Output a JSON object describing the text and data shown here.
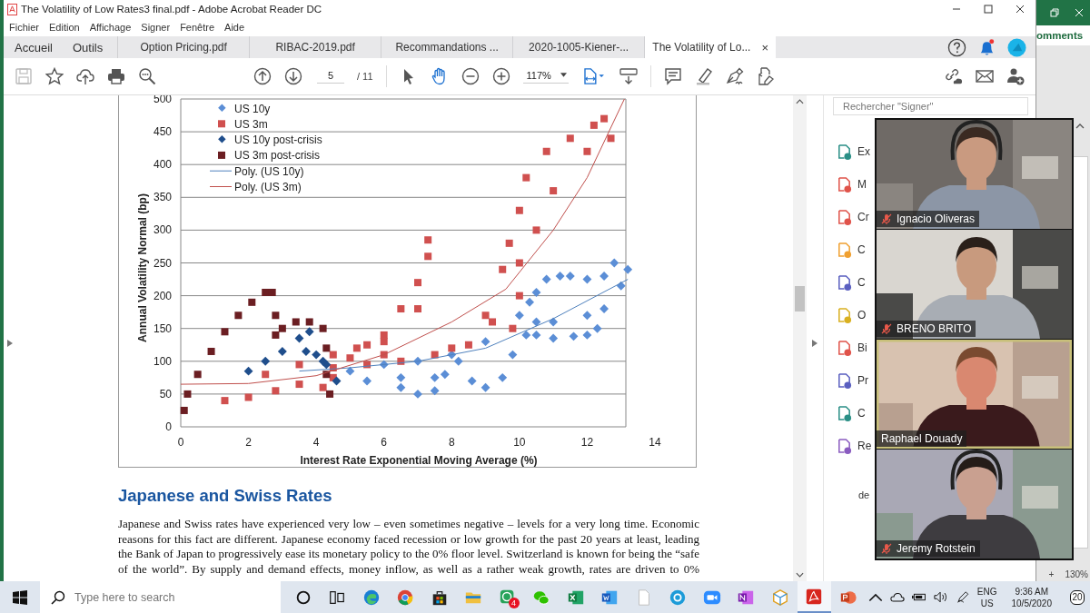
{
  "window": {
    "title": "The Volatility of Low Rates3 final.pdf - Adobe Acrobat Reader DC"
  },
  "menu": [
    "Fichier",
    "Edition",
    "Affichage",
    "Signer",
    "Fenêtre",
    "Aide"
  ],
  "nav_tabs": [
    {
      "label": "Accueil"
    },
    {
      "label": "Outils"
    }
  ],
  "doc_tabs": [
    {
      "label": "Option Pricing.pdf",
      "selected": false
    },
    {
      "label": "RIBAC-2019.pdf",
      "selected": false
    },
    {
      "label": "Recommandations ...",
      "selected": false
    },
    {
      "label": "2020-1005-Kiener-...",
      "selected": false
    },
    {
      "label": "The Volatility of Lo...",
      "selected": true,
      "close": "×"
    }
  ],
  "toolbar": {
    "save_disabled": true,
    "page": "5",
    "page_count": "/ 11",
    "zoom": "117%",
    "tools": [
      {
        "kind": "pointer",
        "selected": false
      },
      {
        "kind": "hand",
        "selected": true
      }
    ]
  },
  "chart_data": {
    "type": "scatter",
    "xlabel": "Interest Rate Exponential Moving Average (%)",
    "ylabel": "Annual Volatility Normal (bp)",
    "xlim": [
      0,
      14
    ],
    "ylim": [
      0,
      500
    ],
    "grid": true,
    "legend": "top-left",
    "xticks": [
      0,
      2,
      4,
      6,
      8,
      10,
      12,
      14
    ],
    "yticks": [
      0,
      50,
      100,
      150,
      200,
      250,
      300,
      350,
      400,
      450,
      500
    ],
    "series": [
      {
        "name": "US 10y",
        "color": "#5b8ed6",
        "x": [
          6.5,
          7,
          7.5,
          7.8,
          8.2,
          8.6,
          9,
          9.5,
          9.8,
          10.2,
          10.5,
          11,
          11.6,
          12,
          12.3,
          10.5,
          10,
          10.3,
          10.5,
          10.8,
          11.2,
          11.5,
          12,
          12.5,
          12.8,
          13.2,
          13,
          12.5,
          12,
          11,
          9,
          8,
          7,
          6,
          5,
          5.5,
          6.5,
          7.5
        ],
        "values": [
          60,
          50,
          55,
          80,
          100,
          70,
          60,
          75,
          110,
          140,
          140,
          135,
          138,
          140,
          150,
          160,
          170,
          190,
          205,
          225,
          230,
          230,
          225,
          230,
          250,
          240,
          215,
          180,
          170,
          160,
          130,
          110,
          100,
          95,
          85,
          70,
          75,
          75
        ]
      },
      {
        "name": "US 3m",
        "color": "#d0504f",
        "x": [
          1.3,
          2,
          2.8,
          3.5,
          4.2,
          4.5,
          2.5,
          3.5,
          4.5,
          5.5,
          6,
          6.5,
          7,
          7.3,
          7.3,
          7,
          6,
          5.2,
          4.5,
          5.5,
          6.5,
          7.5,
          8.5,
          9,
          9.8,
          10,
          9.5,
          9.7,
          10,
          10.2,
          10.8,
          11.5,
          12.2,
          12.5,
          12.7,
          12,
          11,
          10.5,
          10,
          9.2,
          8,
          6,
          5
        ],
        "values": [
          40,
          45,
          55,
          65,
          60,
          75,
          80,
          95,
          110,
          125,
          140,
          180,
          220,
          260,
          285,
          180,
          130,
          120,
          90,
          95,
          100,
          110,
          125,
          170,
          150,
          200,
          240,
          280,
          330,
          380,
          420,
          440,
          460,
          470,
          440,
          420,
          360,
          300,
          250,
          160,
          120,
          110,
          105
        ]
      },
      {
        "name": "US 10y post-crisis",
        "color": "#1f4e8c",
        "x": [
          2,
          2.5,
          3,
          3.5,
          3.8,
          3.7,
          4,
          4.3,
          4.6,
          4.2
        ],
        "values": [
          85,
          100,
          115,
          135,
          145,
          115,
          110,
          95,
          70,
          100
        ]
      },
      {
        "name": "US 3m post-crisis",
        "color": "#6b1e22",
        "x": [
          0.1,
          0.2,
          0.5,
          0.9,
          1.3,
          1.7,
          2.1,
          2.5,
          2.7,
          2.8,
          2.8,
          3,
          3.4,
          3.8,
          4.2,
          4.3,
          4.3,
          4.4
        ],
        "values": [
          25,
          50,
          80,
          115,
          145,
          170,
          190,
          205,
          205,
          170,
          140,
          150,
          160,
          160,
          150,
          120,
          80,
          50
        ]
      },
      {
        "name": "Poly. (US 10y)",
        "type": "line",
        "color": "#4f81bd",
        "x": [
          3.5,
          5,
          7,
          9,
          11,
          13.2
        ],
        "values": [
          85,
          90,
          100,
          120,
          165,
          225
        ]
      },
      {
        "name": "Poly. (US 3m)",
        "type": "line",
        "color": "#c0504d",
        "x": [
          0,
          2,
          4,
          6,
          8,
          9.6,
          11,
          12,
          13.1
        ],
        "values": [
          65,
          66,
          78,
          110,
          160,
          210,
          300,
          380,
          500
        ]
      }
    ]
  },
  "document": {
    "heading": "Japanese and Swiss Rates",
    "paragraph": "Japanese and Swiss rates have experienced very low – even sometimes negative – levels for a very long time. Economic reasons for this fact are different. Japanese economy faced recession or low growth for the past 20 years at least, leading the Bank of Japan to progressively ease its monetary policy to the 0% floor level. Switzerland is known for being the “safe of the world”. By supply and demand effects, money inflow, as well as a rather weak growth, rates are driven to 0%"
  },
  "tools_panel": {
    "search_placeholder": "Rechercher \"Signer\"",
    "items": [
      {
        "label": "Ex",
        "color": "#2a8f86"
      },
      {
        "label": "M",
        "color": "#e0534a"
      },
      {
        "label": "Cr",
        "color": "#e0534a"
      },
      {
        "label": "C",
        "color": "#f0a030"
      },
      {
        "label": "C",
        "color": "#5a5fc0"
      },
      {
        "label": "O",
        "color": "#d9b020"
      },
      {
        "label": "Bi",
        "color": "#e0534a"
      },
      {
        "label": "Pr",
        "color": "#5a5fc0"
      },
      {
        "label": "C",
        "color": "#2a8f86"
      },
      {
        "label": "Re",
        "color": "#8a5cc0"
      }
    ],
    "footer": "de"
  },
  "video": [
    {
      "name": "Ignacio Oliveras",
      "muted": true,
      "speaking": false
    },
    {
      "name": "BRENO BRITO",
      "muted": true,
      "speaking": false
    },
    {
      "name": "Raphael Douady",
      "muted": false,
      "speaking": true
    },
    {
      "name": "Jeremy Rotstein",
      "muted": true,
      "speaking": false
    }
  ],
  "excel": {
    "ribbon_label": "omments",
    "zoom_plus": "+",
    "zoom": "130%"
  },
  "taskbar": {
    "search_placeholder": "Type here to search",
    "apps": [
      {
        "kind": "cortana",
        "active": false
      },
      {
        "kind": "taskview",
        "active": false
      },
      {
        "kind": "browser",
        "active": false
      },
      {
        "kind": "browser2",
        "active": false
      },
      {
        "kind": "store",
        "active": false
      },
      {
        "kind": "folder",
        "active": false
      },
      {
        "kind": "chat",
        "active": false,
        "badge": "4"
      },
      {
        "kind": "chat2",
        "active": false
      },
      {
        "kind": "sheet",
        "active": false
      },
      {
        "kind": "doc",
        "active": false
      },
      {
        "kind": "file",
        "active": false
      },
      {
        "kind": "call",
        "active": false
      },
      {
        "kind": "video",
        "active": false
      },
      {
        "kind": "notes",
        "active": false
      },
      {
        "kind": "cube",
        "active": false
      },
      {
        "kind": "pdf",
        "active": true
      },
      {
        "kind": "slides",
        "active": false
      }
    ],
    "language": "ENG",
    "region": "US",
    "time": "9:36 AM",
    "date": "10/5/2020",
    "notifications": "20"
  }
}
